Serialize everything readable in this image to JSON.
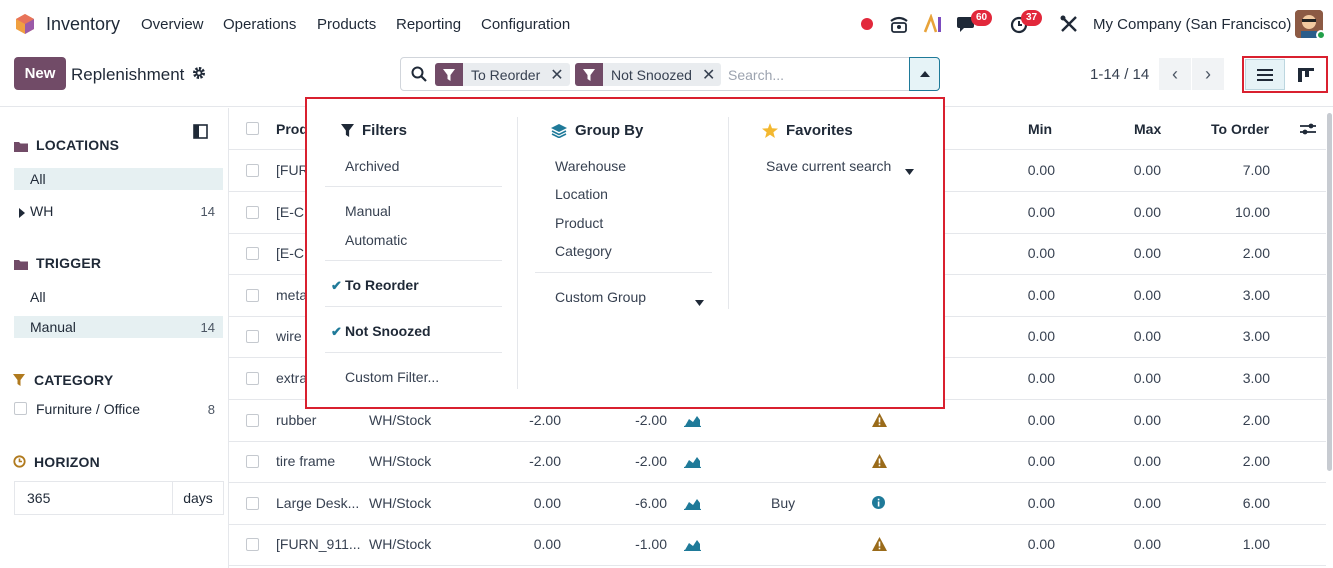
{
  "navbar": {
    "app_name": "Inventory",
    "menu": [
      "Overview",
      "Operations",
      "Products",
      "Reporting",
      "Configuration"
    ],
    "messages_count": "60",
    "activities_count": "37",
    "company": "My Company (San Francisco)"
  },
  "control_panel": {
    "new_label": "New",
    "title": "Replenishment",
    "facets": [
      "To Reorder",
      "Not Snoozed"
    ],
    "search_placeholder": "Search...",
    "pager": "1-14 / 14"
  },
  "sidebar": {
    "locations": {
      "title": "LOCATIONS",
      "items": [
        {
          "label": "All",
          "count": ""
        },
        {
          "label": "WH",
          "count": "14"
        }
      ]
    },
    "trigger": {
      "title": "TRIGGER",
      "items": [
        {
          "label": "All",
          "count": ""
        },
        {
          "label": "Manual",
          "count": "14"
        }
      ]
    },
    "category": {
      "title": "CATEGORY",
      "items": [
        {
          "label": "Furniture / Office",
          "count": "8"
        }
      ]
    },
    "horizon": {
      "title": "HORIZON",
      "value": "365",
      "unit": "days"
    }
  },
  "list": {
    "headers": {
      "product": "Prod",
      "min": "Min",
      "max": "Max",
      "to_order": "To Order"
    },
    "rows": [
      {
        "product": "[FUR",
        "location": "",
        "on_hand": "",
        "forecast": "",
        "route": "",
        "alert": "",
        "min": "0.00",
        "max": "0.00",
        "to_order": "7.00"
      },
      {
        "product": "[E-C",
        "location": "",
        "on_hand": "",
        "forecast": "",
        "route": "",
        "alert": "",
        "min": "0.00",
        "max": "0.00",
        "to_order": "10.00"
      },
      {
        "product": "[E-C",
        "location": "",
        "on_hand": "",
        "forecast": "",
        "route": "",
        "alert": "",
        "min": "0.00",
        "max": "0.00",
        "to_order": "2.00"
      },
      {
        "product": "meta",
        "location": "",
        "on_hand": "",
        "forecast": "",
        "route": "",
        "alert": "",
        "min": "0.00",
        "max": "0.00",
        "to_order": "3.00"
      },
      {
        "product": "wire",
        "location": "",
        "on_hand": "",
        "forecast": "",
        "route": "",
        "alert": "",
        "min": "0.00",
        "max": "0.00",
        "to_order": "3.00"
      },
      {
        "product": "extra",
        "location": "",
        "on_hand": "",
        "forecast": "",
        "route": "",
        "alert": "",
        "min": "0.00",
        "max": "0.00",
        "to_order": "3.00"
      },
      {
        "product": "rubber",
        "location": "WH/Stock",
        "on_hand": "-2.00",
        "forecast": "-2.00",
        "route": "",
        "alert": "warning",
        "min": "0.00",
        "max": "0.00",
        "to_order": "2.00"
      },
      {
        "product": "tire frame",
        "location": "WH/Stock",
        "on_hand": "-2.00",
        "forecast": "-2.00",
        "route": "",
        "alert": "warning",
        "min": "0.00",
        "max": "0.00",
        "to_order": "2.00"
      },
      {
        "product": "Large Desk...",
        "location": "WH/Stock",
        "on_hand": "0.00",
        "forecast": "-6.00",
        "route": "Buy",
        "alert": "info",
        "min": "0.00",
        "max": "0.00",
        "to_order": "6.00"
      },
      {
        "product": "[FURN_911...",
        "location": "WH/Stock",
        "on_hand": "0.00",
        "forecast": "-1.00",
        "route": "",
        "alert": "warning",
        "min": "0.00",
        "max": "0.00",
        "to_order": "1.00"
      }
    ]
  },
  "dropdown": {
    "filters": {
      "title": "Filters",
      "archived": "Archived",
      "manual": "Manual",
      "automatic": "Automatic",
      "to_reorder": "To Reorder",
      "not_snoozed": "Not Snoozed",
      "custom": "Custom Filter..."
    },
    "group_by": {
      "title": "Group By",
      "items": [
        "Warehouse",
        "Location",
        "Product",
        "Category"
      ],
      "custom": "Custom Group"
    },
    "favorites": {
      "title": "Favorites",
      "save": "Save current search"
    }
  }
}
